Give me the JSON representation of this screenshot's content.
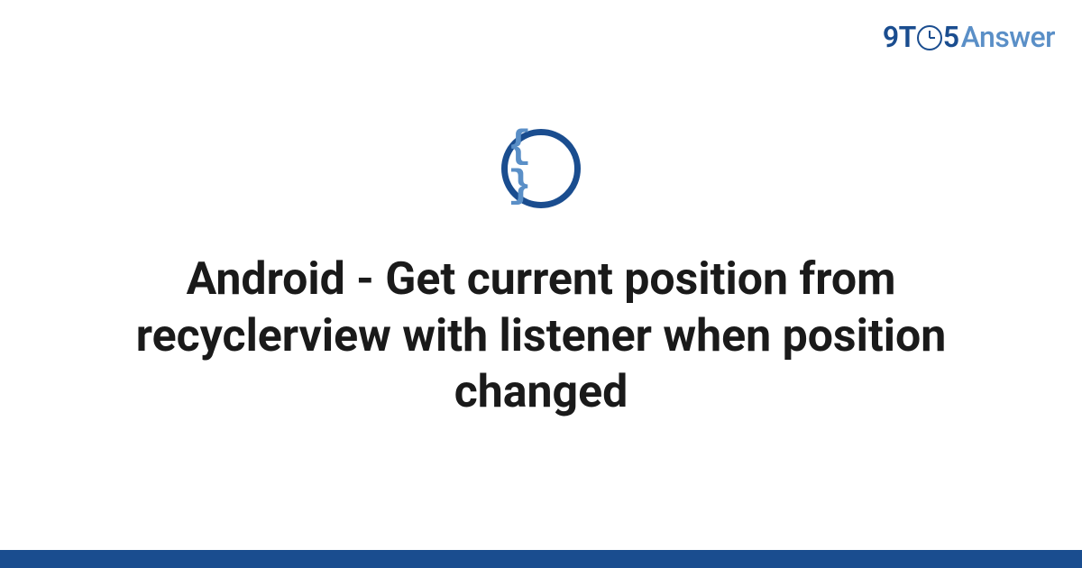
{
  "logo": {
    "part1": "9T",
    "part2": "5",
    "part3": "Answer"
  },
  "icon": {
    "glyph": "{ }",
    "name": "code-braces"
  },
  "title": "Android - Get current position from recyclerview with listener when position changed",
  "colors": {
    "primary": "#1a4d8f",
    "accent": "#5a8fc7",
    "text": "#1a1a1a"
  }
}
